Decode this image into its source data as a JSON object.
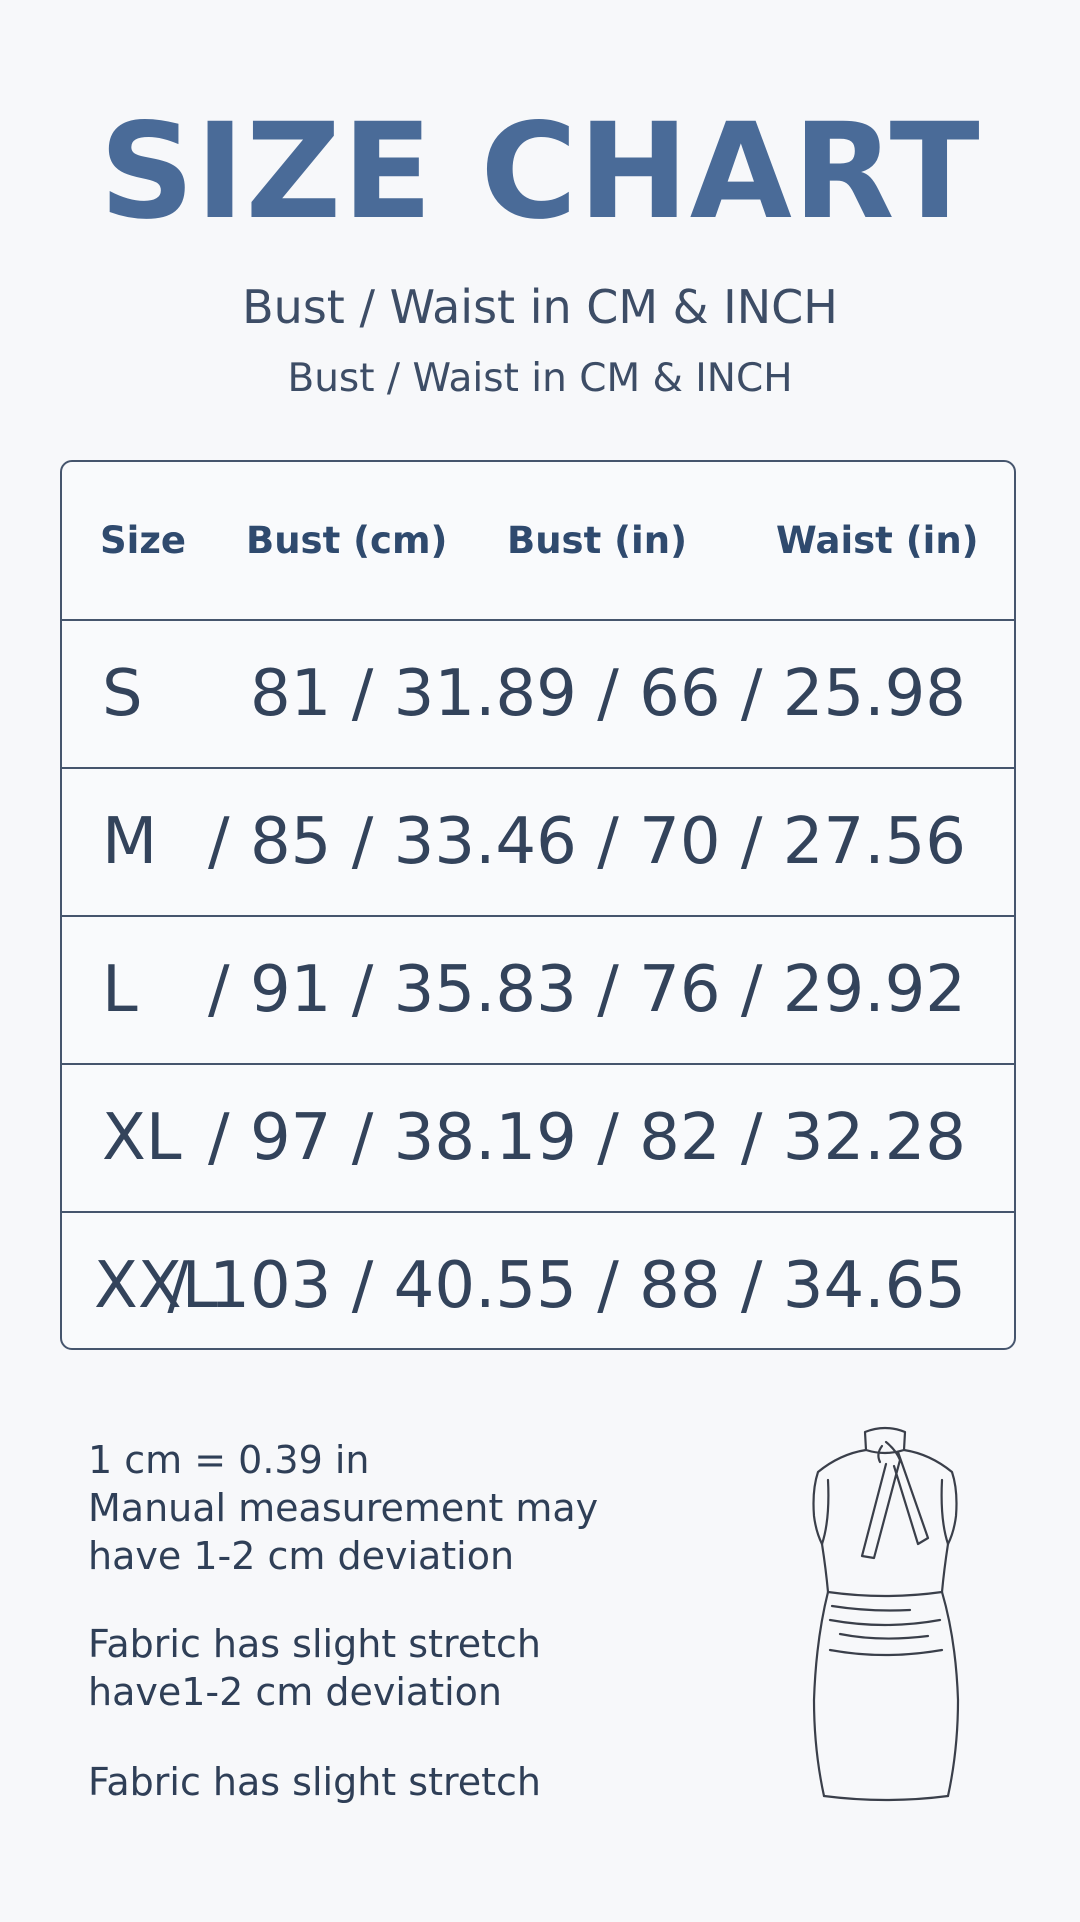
{
  "title": "SIZE CHART",
  "subtitle_1": "Bust / Waist in CM & INCH",
  "subtitle_2": "Bust / Waist in CM & INCH",
  "table": {
    "headers": [
      "Size",
      "Bust (cm)",
      "Bust (in)",
      "Waist (in)"
    ],
    "rows": [
      {
        "size": "S",
        "values": "81 / 31.89 / 66 / 25.98"
      },
      {
        "size": "M",
        "values": "/ 85 / 33.46 / 70 / 27.56"
      },
      {
        "size": "L",
        "values": "/ 91 / 35.83 / 76 / 29.92"
      },
      {
        "size": "XL",
        "values": "/ 97 / 38.19 / 82 / 32.28"
      },
      {
        "size": "XXL",
        "values": "/ 103 / 40.55 / 88 / 34.65"
      }
    ]
  },
  "notes": {
    "line_1": "1 cm = 0.39 in",
    "line_2": "Manual measurement may",
    "line_3": "have 1-2 cm deviation",
    "line_4": "Fabric has slight stretch",
    "line_5": "have1-2 cm deviation",
    "line_6": "Fabric has slight stretch"
  },
  "colors": {
    "title": "#4a6b98",
    "text": "#2f3f57",
    "border": "#46556d",
    "background": "#f7f8fa"
  },
  "illustration": "dress-icon"
}
